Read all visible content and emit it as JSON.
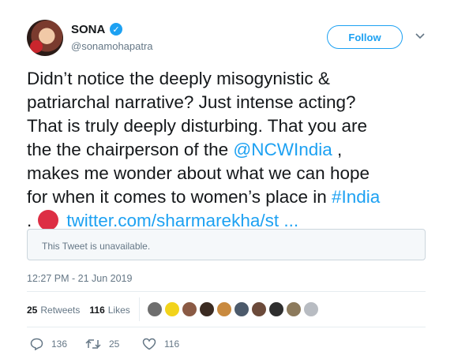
{
  "user": {
    "display_name": "SONA",
    "handle": "@sonamohapatra",
    "verified": true,
    "avatar_icon": "profile-photo"
  },
  "header": {
    "follow_label": "Follow",
    "more_icon": "chevron-down-icon"
  },
  "tweet": {
    "line1": "Didn’t notice the deeply misogynistic &",
    "line2": "patriarchal narrative? Just intense acting?",
    "line3": "That is truly deeply disturbing. That you are",
    "line4_a": "the the chairperson of the ",
    "mention": "@NCWIndia",
    "line4_b": " ,",
    "line5": "makes me wonder about what we can hope",
    "line6_a": "for when it comes to women’s place in ",
    "hashtag": "#India",
    "line7_a": ".",
    "emoji": "red-circle",
    "link": "twitter.com/sharmarekha/st ..."
  },
  "quoted": {
    "text": "This Tweet is unavailable."
  },
  "timestamp": "12:27 PM - 21 Jun 2019",
  "stats": {
    "retweets_count": "25",
    "retweets_label": "Retweets",
    "likes_count": "116",
    "likes_label": "Likes"
  },
  "likers": [
    {
      "name": "liker-1",
      "color": "#6e6e6e"
    },
    {
      "name": "liker-2",
      "color": "#f2d31b"
    },
    {
      "name": "liker-3",
      "color": "#8a5a44"
    },
    {
      "name": "liker-4",
      "color": "#3b2b22"
    },
    {
      "name": "liker-5",
      "color": "#c98a3f"
    },
    {
      "name": "liker-6",
      "color": "#4c5a6b"
    },
    {
      "name": "liker-7",
      "color": "#6b4a3a"
    },
    {
      "name": "liker-8",
      "color": "#2e2e2e"
    },
    {
      "name": "liker-9",
      "color": "#8c7a5c"
    },
    {
      "name": "liker-10",
      "color": "#b8bcc2"
    }
  ],
  "actions": {
    "replies": "136",
    "retweets": "25",
    "likes": "116"
  },
  "colors": {
    "accent": "#1da1f2",
    "secondary_text": "#657786",
    "border": "#e6ecf0"
  }
}
